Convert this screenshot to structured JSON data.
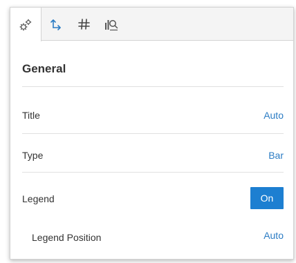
{
  "tabs": [
    {
      "icon": "gears-icon",
      "active": true
    },
    {
      "icon": "axis-icon",
      "active": false
    },
    {
      "icon": "hash-icon",
      "active": false
    },
    {
      "icon": "chart-search-icon",
      "active": false
    }
  ],
  "section": {
    "title": "General"
  },
  "rows": {
    "title": {
      "label": "Title",
      "value": "Auto"
    },
    "type": {
      "label": "Type",
      "value": "Bar"
    },
    "legend": {
      "label": "Legend",
      "value": "On"
    },
    "legend_position": {
      "label": "Legend Position",
      "value": "Auto"
    }
  },
  "colors": {
    "accent": "#1d7fd1",
    "link": "#2b7cc4",
    "text": "#333333"
  }
}
